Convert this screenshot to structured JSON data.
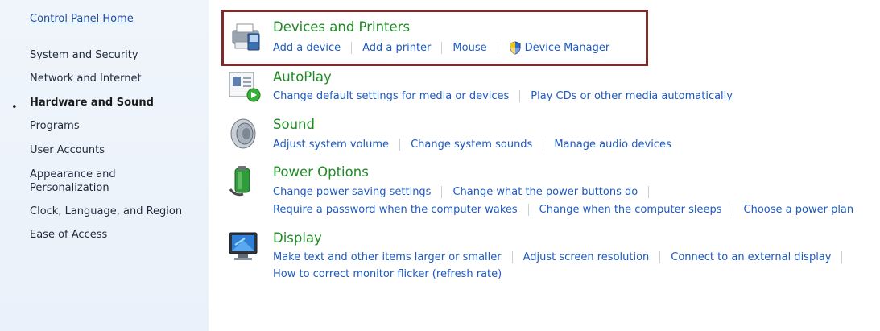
{
  "sidebar": {
    "home": "Control Panel Home",
    "bullet": "•",
    "items": [
      {
        "label": "System and Security",
        "active": false
      },
      {
        "label": "Network and Internet",
        "active": false
      },
      {
        "label": "Hardware and Sound",
        "active": true
      },
      {
        "label": "Programs",
        "active": false
      },
      {
        "label": "User Accounts",
        "active": false
      },
      {
        "label": "Appearance and Personalization",
        "active": false
      },
      {
        "label": "Clock, Language, and Region",
        "active": false
      },
      {
        "label": "Ease of Access",
        "active": false
      }
    ]
  },
  "categories": {
    "devices": {
      "title": "Devices and Printers",
      "icon": "printer-icon",
      "links": [
        "Add a device",
        "Add a printer",
        "Mouse",
        "Device Manager"
      ],
      "shield_icon": "uac-shield-icon"
    },
    "autoplay": {
      "title": "AutoPlay",
      "icon": "autoplay-icon",
      "links": [
        "Change default settings for media or devices",
        "Play CDs or other media automatically"
      ]
    },
    "sound": {
      "title": "Sound",
      "icon": "speaker-icon",
      "links": [
        "Adjust system volume",
        "Change system sounds",
        "Manage audio devices"
      ]
    },
    "power": {
      "title": "Power Options",
      "icon": "battery-icon",
      "links_row1": [
        "Change power-saving settings",
        "Change what the power buttons do"
      ],
      "links_row2": [
        "Require a password when the computer wakes",
        "Change when the computer sleeps",
        "Choose a power plan"
      ]
    },
    "display": {
      "title": "Display",
      "icon": "monitor-icon",
      "links_row1": [
        "Make text and other items larger or smaller",
        "Adjust screen resolution",
        "Connect to an external display"
      ],
      "links_row2": [
        "How to correct monitor flicker (refresh rate)"
      ]
    }
  },
  "colors": {
    "title_green": "#1e8b25",
    "link_blue": "#1d5ac2",
    "highlight_border": "#7d2b2b",
    "sidebar_bg": "#eaf1fa"
  }
}
